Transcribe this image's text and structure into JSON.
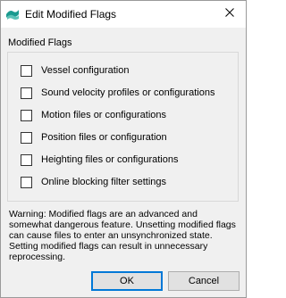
{
  "window": {
    "title": "Edit Modified Flags",
    "icon": "app-logo-icon",
    "close_icon": "close-icon"
  },
  "group": {
    "label": "Modified Flags",
    "options": [
      {
        "label": "Vessel configuration",
        "checked": false
      },
      {
        "label": "Sound velocity profiles or configurations",
        "checked": false
      },
      {
        "label": "Motion files or configurations",
        "checked": false
      },
      {
        "label": "Position files or configuration",
        "checked": false
      },
      {
        "label": "Heighting files or configurations",
        "checked": false
      },
      {
        "label": "Online blocking filter settings",
        "checked": false
      }
    ]
  },
  "warning": "Warning: Modified flags are an advanced and somewhat dangerous feature. Unsetting modified flags can cause files to enter an unsynchronized state. Setting modified flags can result in unnecessary reprocessing.",
  "buttons": {
    "ok": "OK",
    "cancel": "Cancel"
  },
  "colors": {
    "accent": "#0078d7",
    "window_bg": "#f0f0f0",
    "titlebar_bg": "#ffffff"
  }
}
